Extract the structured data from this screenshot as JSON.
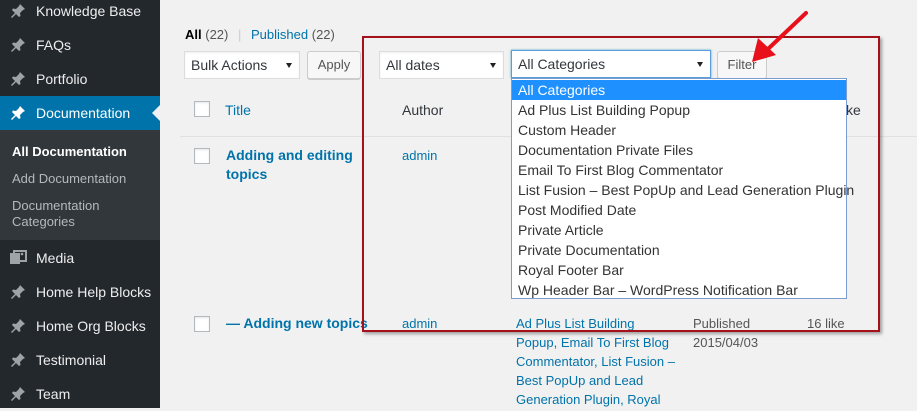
{
  "sidebar": {
    "items": [
      {
        "label": "Knowledge Base",
        "icon": "pin-icon"
      },
      {
        "label": "FAQs",
        "icon": "pin-icon"
      },
      {
        "label": "Portfolio",
        "icon": "pin-icon"
      },
      {
        "label": "Documentation",
        "icon": "pin-icon",
        "current": true
      },
      {
        "label": "Media",
        "icon": "media-icon"
      },
      {
        "label": "Home Help Blocks",
        "icon": "pin-icon"
      },
      {
        "label": "Home Org Blocks",
        "icon": "pin-icon"
      },
      {
        "label": "Testimonial",
        "icon": "pin-icon"
      },
      {
        "label": "Team",
        "icon": "pin-icon"
      }
    ],
    "submenu": [
      {
        "label": "All Documentation"
      },
      {
        "label": "Add Documentation"
      },
      {
        "label": "Documentation Categories"
      }
    ]
  },
  "views": {
    "all_label": "All",
    "all_count": "(22)",
    "separator": "|",
    "published_label": "Published",
    "published_count": "(22)"
  },
  "toolbar": {
    "bulk_actions": "Bulk Actions",
    "apply": "Apply",
    "dates": "All dates",
    "categories": "All Categories",
    "filter": "Filter"
  },
  "table": {
    "headers": {
      "title": "Title",
      "author": "Author",
      "likes_partial": "ke"
    },
    "rows": [
      {
        "title_line1": "Adding and editing",
        "title_line2": "topics",
        "author": "admin"
      },
      {
        "title": "— Adding new topics",
        "author": "admin",
        "categories": [
          "Ad Plus List Building",
          "Popup, Email To First Blog",
          "Commentator, List Fusion –",
          "Best PopUp and Lead",
          "Generation Plugin, Royal"
        ],
        "status": "Published",
        "date": "2015/04/03",
        "likes": "16 like"
      }
    ]
  },
  "dropdown": {
    "options": [
      "All Categories",
      "Ad Plus List Building Popup",
      "Custom Header",
      "Documentation Private Files",
      "Email To First Blog Commentator",
      "List Fusion – Best PopUp and Lead Generation Plugin",
      "Post Modified Date",
      "Private Article",
      "Private Documentation",
      "Royal Footer Bar",
      "Wp Header Bar – WordPress Notification Bar"
    ],
    "selected_index": 0
  },
  "colors": {
    "sidebar_bg": "#23282d",
    "accent": "#0073aa",
    "annotation": "#a4111a",
    "arrow": "#e8111b"
  }
}
